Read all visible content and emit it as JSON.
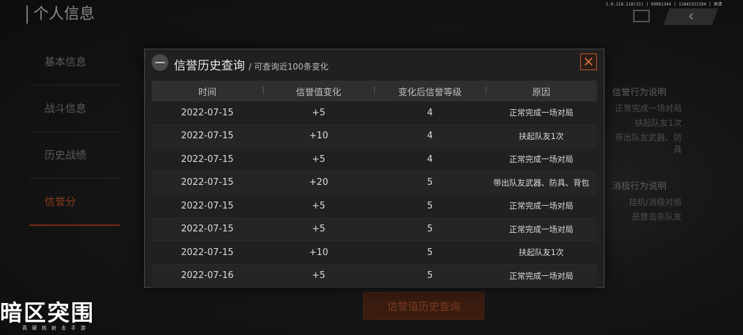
{
  "version_text": "1.0.118.118(15) | 09081344 | 11845321394 | 高清",
  "page_title": "个人信息",
  "sidebar": {
    "items": [
      {
        "label": "基本信息"
      },
      {
        "label": "战斗信息"
      },
      {
        "label": "历史战绩"
      },
      {
        "label": "信誉分"
      }
    ]
  },
  "right_panel": {
    "positive_title": "信誉行为说明",
    "positive_lines": [
      "正常完成一场对局",
      "扶起队友1次",
      "带出队友武器、防具"
    ],
    "negative_title": "消极行为说明",
    "negative_lines": [
      "挂机/消极对局",
      "恶意击杀队友"
    ]
  },
  "bottom_button": "信誉值历史查询",
  "logo": {
    "main": "暗区突围",
    "sub": "真硬核射击手游"
  },
  "modal": {
    "title": "信誉历史查询",
    "subtitle": "/ 可查询近100条变化",
    "close_label": "×",
    "columns": [
      "时间",
      "信誉值变化",
      "变化后信誉等级",
      "原因"
    ],
    "rows": [
      {
        "date": "2022-07-15",
        "change": "+5",
        "level": "4",
        "reason": "正常完成一场对局"
      },
      {
        "date": "2022-07-15",
        "change": "+10",
        "level": "4",
        "reason": "扶起队友1次"
      },
      {
        "date": "2022-07-15",
        "change": "+5",
        "level": "4",
        "reason": "正常完成一场对局"
      },
      {
        "date": "2022-07-15",
        "change": "+20",
        "level": "5",
        "reason": "带出队友武器、防具、背包"
      },
      {
        "date": "2022-07-15",
        "change": "+5",
        "level": "5",
        "reason": "正常完成一场对局"
      },
      {
        "date": "2022-07-15",
        "change": "+5",
        "level": "5",
        "reason": "正常完成一场对局"
      },
      {
        "date": "2022-07-15",
        "change": "+10",
        "level": "5",
        "reason": "扶起队友1次"
      },
      {
        "date": "2022-07-16",
        "change": "+5",
        "level": "5",
        "reason": "正常完成一场对局"
      }
    ]
  }
}
